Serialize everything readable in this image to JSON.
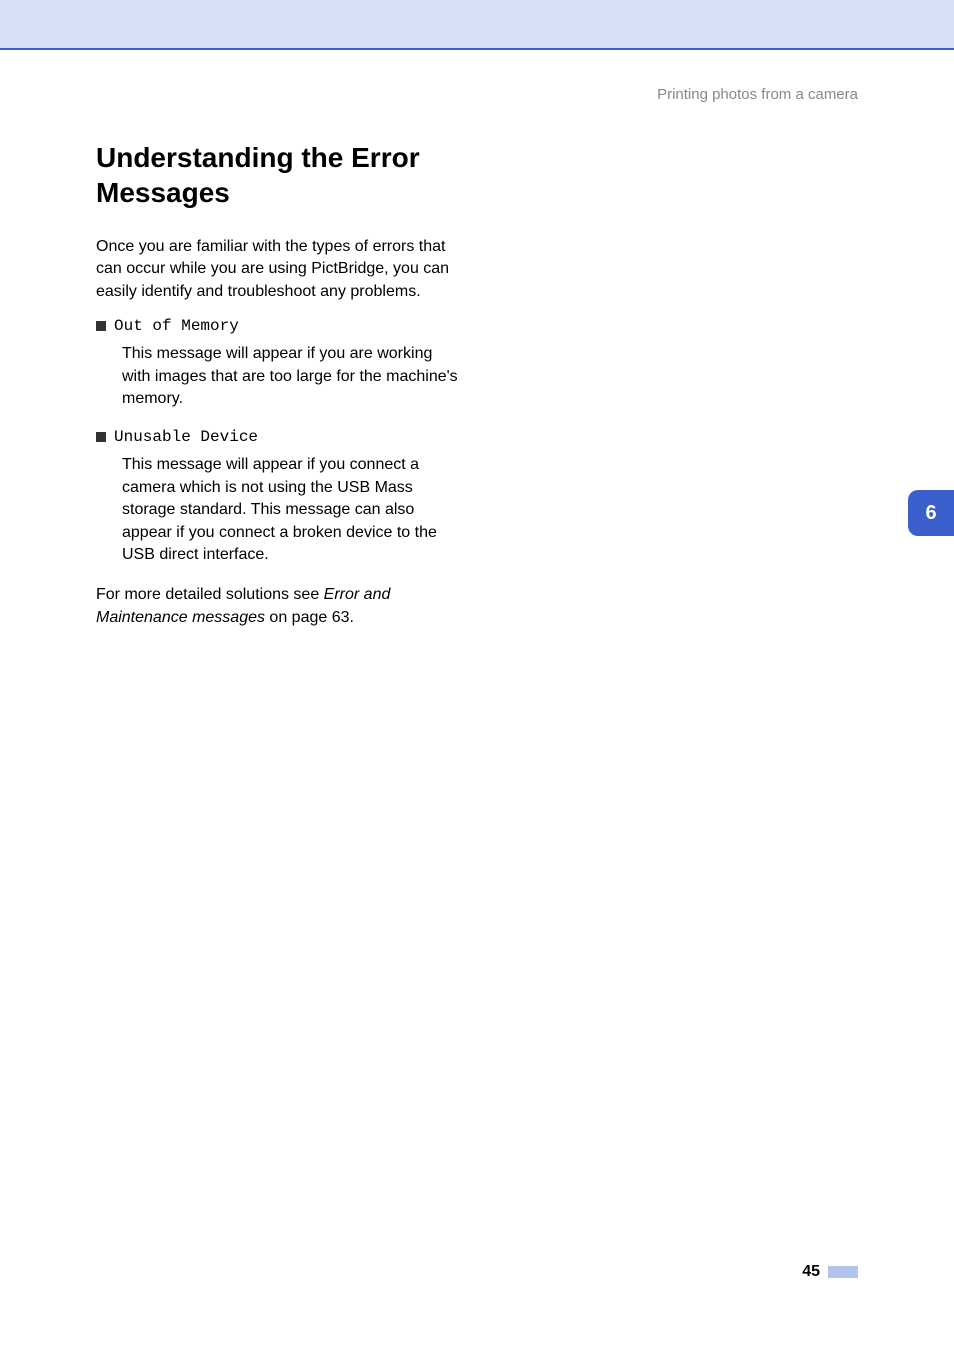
{
  "header": {
    "chapter_label": "Printing photos from a camera"
  },
  "content": {
    "heading": "Understanding the Error Messages",
    "intro": "Once you are familiar with the types of errors that can occur while you are using PictBridge, you can easily identify and troubleshoot any problems.",
    "items": [
      {
        "label": "Out of Memory",
        "description": "This message will appear if you are working with images that are too large for the machine's memory."
      },
      {
        "label": "Unusable Device",
        "description": "This message will appear if you connect a camera which is not using the USB Mass storage standard. This message can also appear if you connect a broken device to the USB direct interface."
      }
    ],
    "closing_prefix": "For more detailed solutions see ",
    "closing_italic": "Error and Maintenance messages",
    "closing_suffix": " on page 63."
  },
  "tab": {
    "number": "6"
  },
  "footer": {
    "page_number": "45"
  }
}
